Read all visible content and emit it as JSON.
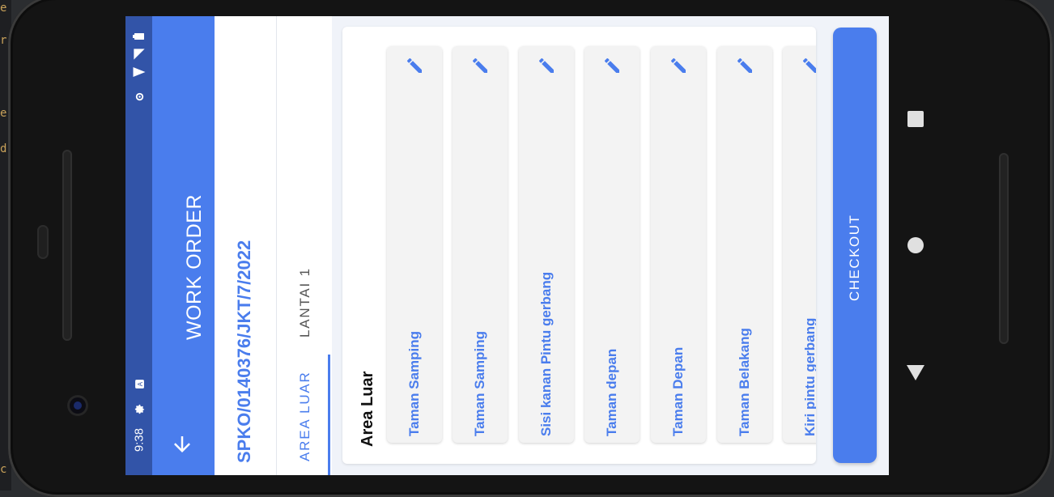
{
  "ide": {
    "glyphs": [
      "e",
      "r",
      "e",
      "d",
      "c"
    ]
  },
  "status_bar": {
    "time": "9:38",
    "icons": [
      "settings-icon",
      "notification-a-icon",
      "location-icon",
      "wifi-icon",
      "signal-icon",
      "battery-icon"
    ]
  },
  "app_bar": {
    "title": "WORK ORDER",
    "back_icon": "arrow-back-icon"
  },
  "work_order": {
    "number": "SPKO/0140376/JKT/7/2022"
  },
  "tabs": [
    {
      "label": "AREA LUAR",
      "selected": true
    },
    {
      "label": "LANTAI 1",
      "selected": false
    }
  ],
  "section": {
    "title": "Area Luar"
  },
  "items": [
    {
      "label": "Taman Samping",
      "edit_icon": "pencil-icon"
    },
    {
      "label": "Taman Samping",
      "edit_icon": "pencil-icon"
    },
    {
      "label": "Sisi kanan Pintu gerbang",
      "edit_icon": "pencil-icon"
    },
    {
      "label": "Taman depan",
      "edit_icon": "pencil-icon"
    },
    {
      "label": "Taman Depan",
      "edit_icon": "pencil-icon"
    },
    {
      "label": "Taman Belakang",
      "edit_icon": "pencil-icon"
    },
    {
      "label": "Kiri pintu gerbang",
      "edit_icon": "pencil-icon"
    }
  ],
  "checkout": {
    "label": "CHECKOUT"
  },
  "colors": {
    "primary": "#4a7ded",
    "status_bar": "#3254a8",
    "card": "#f3f3f3",
    "background": "#f0f3f9"
  }
}
